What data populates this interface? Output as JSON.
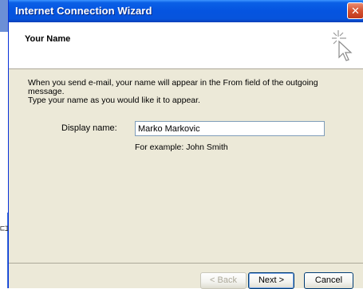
{
  "window": {
    "title": "Internet Connection Wizard",
    "close_label": "✕"
  },
  "header": {
    "title": "Your Name"
  },
  "content": {
    "description_line1": "When you send e-mail, your name will appear in the From field of the outgoing message.",
    "description_line2": "Type your name as you would like it to appear.",
    "display_name_label": "Display name:",
    "display_name_value": "Marko Markovic",
    "example_text": "For example: John Smith"
  },
  "buttons": {
    "back": "< Back",
    "next": "Next >",
    "cancel": "Cancel"
  },
  "colors": {
    "titlebar": "#0554e0",
    "dialog_face": "#ece9d8",
    "close_button": "#d5512f"
  },
  "icons": {
    "wizard_header": "wizard-sparkle-cursor-icon",
    "close": "close-icon"
  }
}
